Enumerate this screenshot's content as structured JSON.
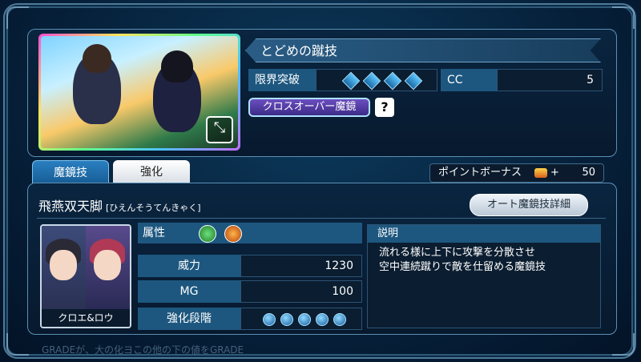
{
  "skill": {
    "name": "とどめの蹴技",
    "limit_break_label": "限界突破",
    "limit_break_level": 4,
    "cc_label": "CC",
    "cc_value": "5",
    "crossover_label": "クロスオーバー魔鏡",
    "help_label": "?"
  },
  "tabs": [
    {
      "label": "魔鏡技",
      "active": true
    },
    {
      "label": "強化",
      "active": false
    }
  ],
  "point_bonus": {
    "label": "ポイントボーナス",
    "suffix": "+",
    "value": "50"
  },
  "mirror_arte": {
    "title": "飛燕双天脚",
    "reading": "[ひえんそうてんきゃく]",
    "auto_detail_label": "オート魔鏡技詳細",
    "character_name": "クロエ&ロウ",
    "attributes_label": "属性",
    "stats": [
      {
        "label": "威力",
        "value": "1230"
      },
      {
        "label": "MG",
        "value": "100"
      },
      {
        "label": "強化段階",
        "value": ""
      }
    ],
    "enhance_level": 5,
    "description_label": "説明",
    "description_lines": [
      "流れる様に上下に攻撃を分散させ",
      "空中連続蹴りで敵を仕留める魔鏡技"
    ]
  },
  "footer": "GRADEが、大の化ヨこの他の下の値をGRADE",
  "icons": {
    "expand": "expand-arrows-icon",
    "wind": "wind-element-icon",
    "fire": "fire-element-icon",
    "bonus": "treasure-icon"
  }
}
